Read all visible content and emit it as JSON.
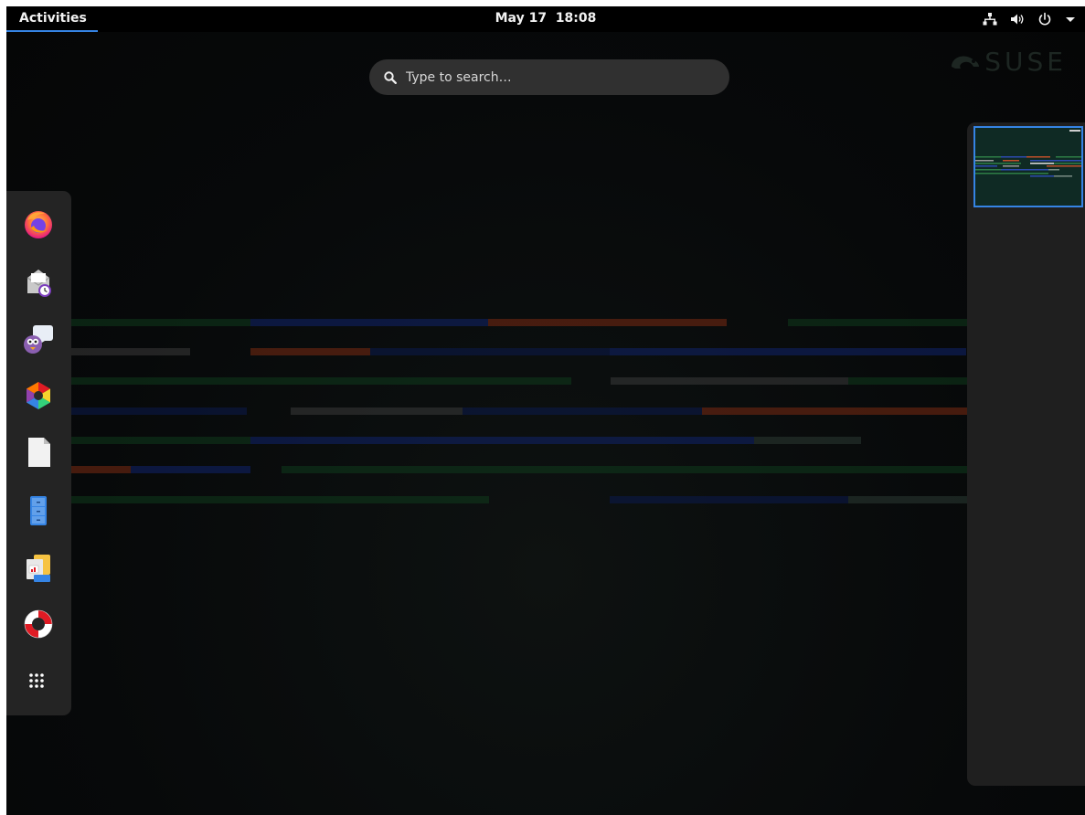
{
  "topbar": {
    "activities_label": "Activities",
    "clock": "May 17  18:08",
    "status_icons": [
      "network-wired-icon",
      "volume-icon",
      "power-icon",
      "menu-down-icon"
    ]
  },
  "search": {
    "placeholder": "Type to search…"
  },
  "brand": {
    "logo_text": "SUSE"
  },
  "dash": {
    "items": [
      {
        "name": "firefox",
        "icon": "firefox-icon"
      },
      {
        "name": "evolution-mail",
        "icon": "mail-clock-icon"
      },
      {
        "name": "pidgin-chat",
        "icon": "pidgin-icon"
      },
      {
        "name": "cheese-camera",
        "icon": "cheese-icon"
      },
      {
        "name": "libreoffice",
        "icon": "document-icon"
      },
      {
        "name": "file-cabinet",
        "icon": "cabinet-icon"
      },
      {
        "name": "libreoffice-impress",
        "icon": "impress-icon"
      },
      {
        "name": "help",
        "icon": "lifebuoy-icon"
      },
      {
        "name": "show-applications",
        "icon": "app-grid-icon"
      }
    ]
  },
  "workspaces": {
    "active": 1,
    "count": 1
  },
  "colors": {
    "accent": "#3584e4",
    "panel": "#242424",
    "topbar": "#000000",
    "search_bg": "#303030"
  }
}
